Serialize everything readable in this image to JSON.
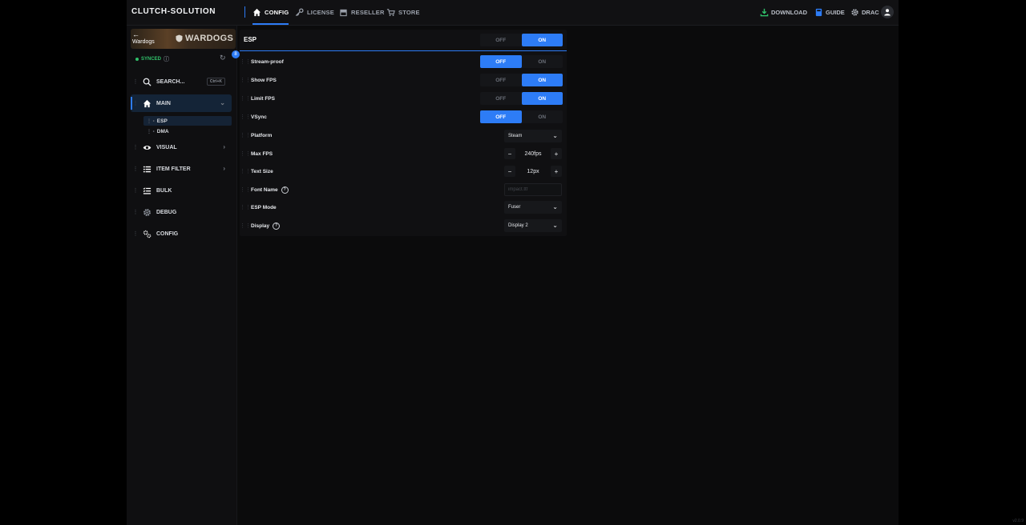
{
  "app": {
    "brand": "CLUTCH-SOLUTION",
    "accent": "#2d7cf6"
  },
  "nav": {
    "tabs": [
      {
        "label": "CONFIG",
        "icon": "home-icon",
        "active": true
      },
      {
        "label": "LICENSE",
        "icon": "key-icon"
      },
      {
        "label": "RESELLER",
        "icon": "store-icon"
      },
      {
        "label": "STORE",
        "icon": "cart-icon"
      }
    ],
    "right": [
      {
        "label": "DOWNLOAD",
        "icon": "download-icon",
        "color": "#30c06a"
      },
      {
        "label": "GUIDE",
        "icon": "book-icon",
        "color": "#2d7cf6"
      },
      {
        "label": "DRAC",
        "icon": "gear-icon"
      }
    ]
  },
  "sidebar": {
    "banner": {
      "back": "←",
      "game": "Wardogs",
      "logo": "WARDOGS",
      "badge": "8"
    },
    "sync_status": "SYNCED",
    "search": {
      "label": "SEARCH...",
      "shortcut": "Ctrl+K"
    },
    "items": [
      {
        "label": "MAIN",
        "icon": "home-icon",
        "active": true
      },
      {
        "label": "VISUAL",
        "icon": "eye-icon"
      },
      {
        "label": "ITEM FILTER",
        "icon": "list-icon"
      },
      {
        "label": "BULK",
        "icon": "checklist-icon"
      },
      {
        "label": "DEBUG",
        "icon": "gear-icon"
      },
      {
        "label": "CONFIG",
        "icon": "settings-icon"
      }
    ],
    "sub_items": [
      {
        "label": "ESP",
        "active": true
      },
      {
        "label": "DMA"
      }
    ]
  },
  "panel": {
    "title": "ESP",
    "master_toggle": {
      "off": "OFF",
      "on": "ON",
      "value": "ON"
    },
    "settings": [
      {
        "label": "Stream-proof",
        "type": "toggle",
        "value": "OFF",
        "off": "OFF",
        "on": "ON"
      },
      {
        "label": "Show FPS",
        "type": "toggle",
        "value": "ON",
        "off": "OFF",
        "on": "ON"
      },
      {
        "label": "Limit FPS",
        "type": "toggle",
        "value": "ON",
        "off": "OFF",
        "on": "ON"
      },
      {
        "label": "VSync",
        "type": "toggle",
        "value": "OFF",
        "off": "OFF",
        "on": "ON"
      },
      {
        "label": "Platform",
        "type": "select",
        "value": "Steam"
      },
      {
        "label": "Max FPS",
        "type": "stepper",
        "value": "240fps",
        "minus": "−",
        "plus": "+"
      },
      {
        "label": "Text Size",
        "type": "stepper",
        "value": "12px",
        "minus": "−",
        "plus": "+"
      },
      {
        "label": "Font Name",
        "type": "text",
        "placeholder": "impact.ttf",
        "help": "?"
      },
      {
        "label": "ESP Mode",
        "type": "select",
        "value": "Fuser"
      },
      {
        "label": "Display",
        "type": "select",
        "value": "Display 2",
        "help": "?"
      }
    ]
  },
  "footer": {
    "version": "v2.0.9"
  }
}
